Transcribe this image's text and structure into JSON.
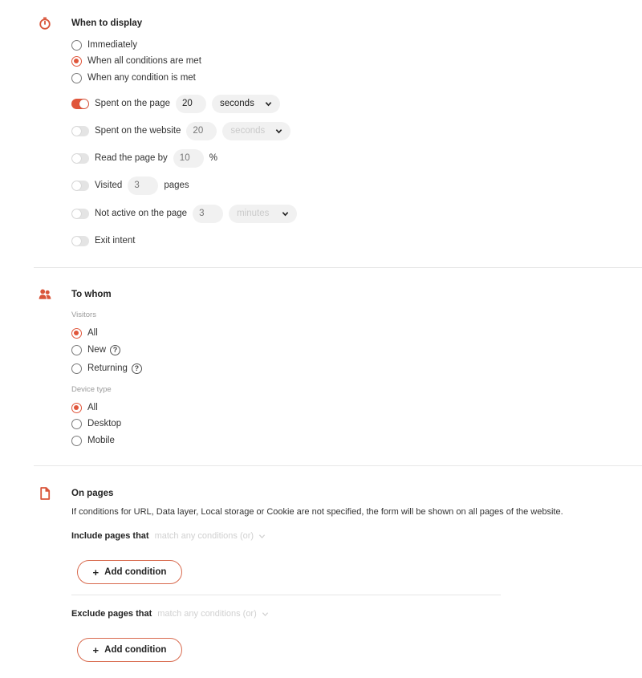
{
  "display": {
    "title": "When to display",
    "icon": "timer-icon",
    "options": [
      {
        "label": "Immediately",
        "checked": false
      },
      {
        "label": "When all conditions are met",
        "checked": true
      },
      {
        "label": "When any condition is met",
        "checked": false
      }
    ],
    "triggers": {
      "spent_page": {
        "label": "Spent on the page",
        "on": true,
        "value": "20",
        "unit": "seconds"
      },
      "spent_site": {
        "label": "Spent on the website",
        "on": false,
        "placeholder": "20",
        "unit": "seconds"
      },
      "read_page": {
        "label": "Read the page by",
        "on": false,
        "placeholder": "10",
        "unit": "%"
      },
      "visited": {
        "label": "Visited",
        "on": false,
        "placeholder": "3",
        "unit": "pages"
      },
      "not_active": {
        "label": "Not active on the page",
        "on": false,
        "placeholder": "3",
        "unit": "minutes"
      },
      "exit_intent": {
        "label": "Exit intent",
        "on": false
      }
    }
  },
  "whom": {
    "title": "To whom",
    "icon": "users-icon",
    "visitors_label": "Visitors",
    "visitors": [
      {
        "label": "All",
        "checked": true
      },
      {
        "label": "New",
        "checked": false,
        "help": "?"
      },
      {
        "label": "Returning",
        "checked": false,
        "help": "?"
      }
    ],
    "device_label": "Device type",
    "devices": [
      {
        "label": "All",
        "checked": true
      },
      {
        "label": "Desktop",
        "checked": false
      },
      {
        "label": "Mobile",
        "checked": false
      }
    ]
  },
  "pages": {
    "title": "On pages",
    "icon": "document-icon",
    "description": "If conditions for URL, Data layer, Local storage or Cookie are not specified, the form will be shown on all pages of the website.",
    "include_label": "Include pages that",
    "include_select": "match any conditions (or)",
    "exclude_label": "Exclude pages that",
    "exclude_select": "match any conditions (or)",
    "add_condition": "Add condition",
    "plus": "+"
  },
  "colors": {
    "accent": "#e0563b",
    "muted": "#d0d0d0"
  }
}
